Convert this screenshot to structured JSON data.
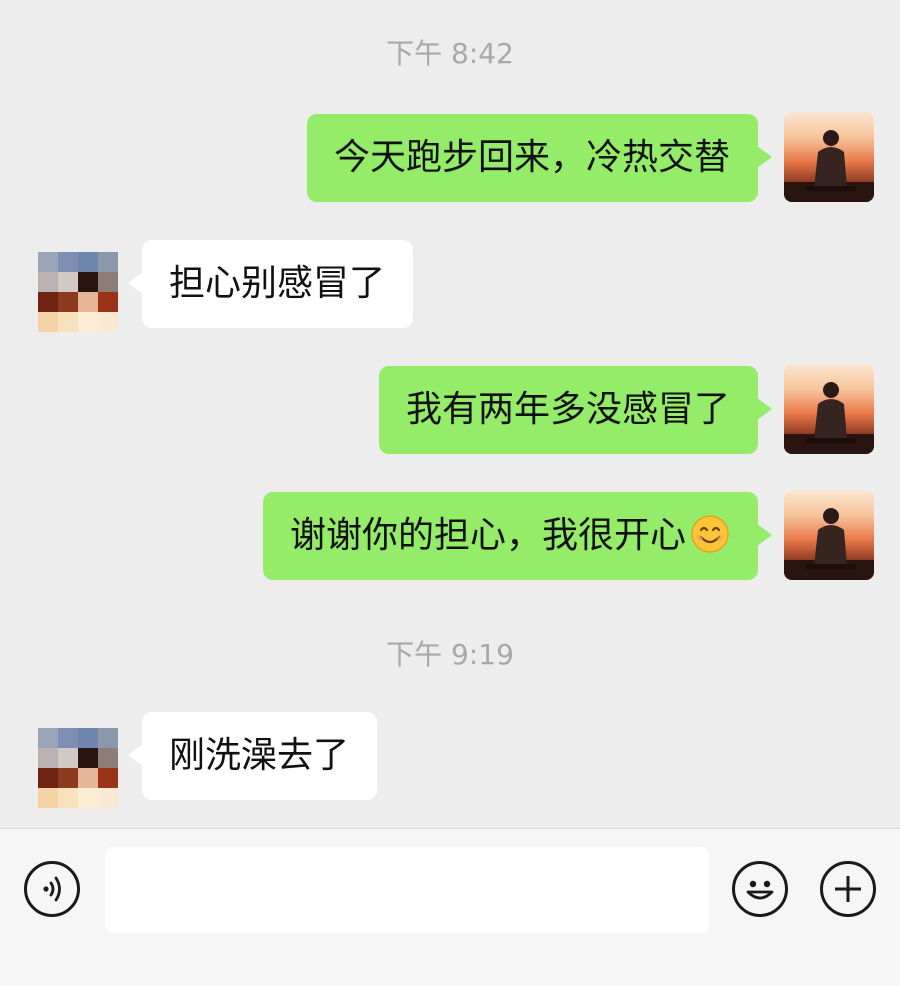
{
  "timestamps": [
    "下午 8:42",
    "下午 9:19"
  ],
  "messages": [
    {
      "side": "me",
      "text": "今天跑步回来，冷热交替"
    },
    {
      "side": "them",
      "text": "担心别感冒了"
    },
    {
      "side": "me",
      "text": "我有两年多没感冒了"
    },
    {
      "side": "me",
      "text": "谢谢你的担心，我很开心",
      "emoji": "smile-emoji"
    },
    {
      "side": "them",
      "text": "刚洗澡去了"
    }
  ],
  "colors": {
    "background": "#ededed",
    "my_bubble": "#95ec69",
    "their_bubble": "#ffffff",
    "timestamp": "#a8a8a8",
    "input_bar": "#f6f6f6"
  },
  "input_bar": {
    "voice_icon": "voice-icon",
    "input_value": "",
    "emoji_icon": "emoji-icon",
    "plus_icon": "plus-icon"
  },
  "avatars": {
    "me": "sunset-silhouette-avatar",
    "them": "pixelated-avatar"
  }
}
